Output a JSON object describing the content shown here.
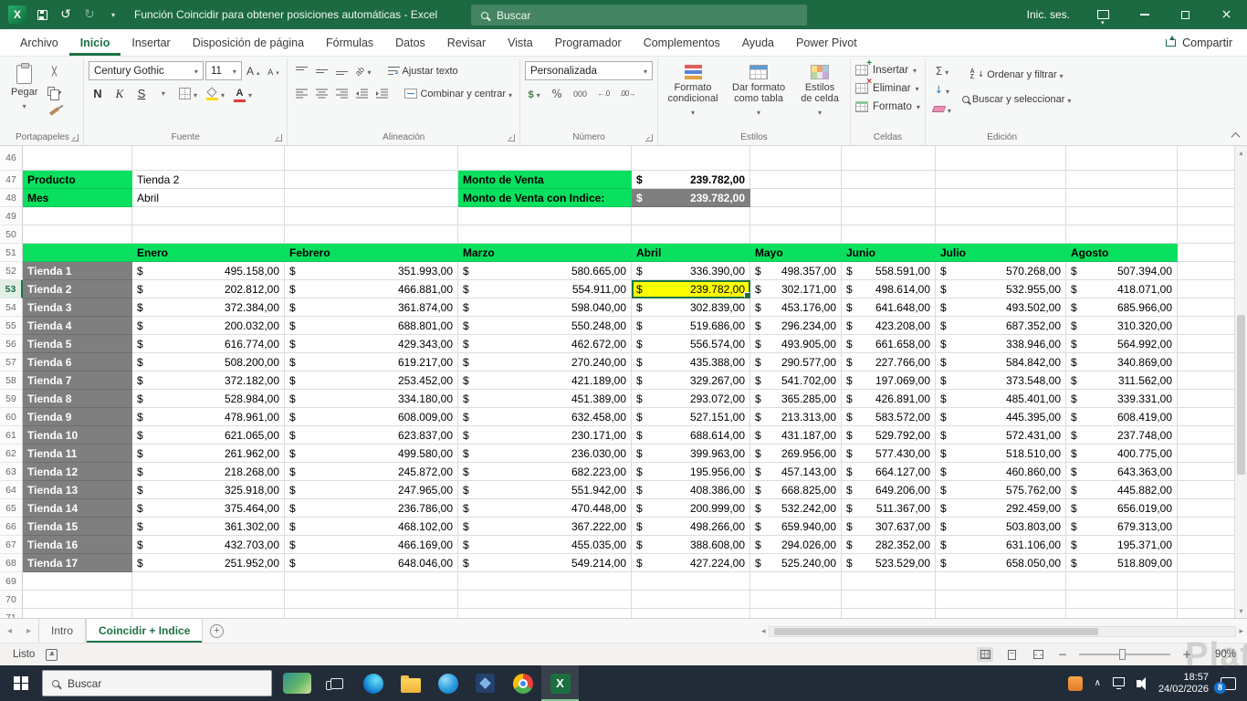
{
  "colors": {
    "titlebar_green": "#1b6a41",
    "accent_green": "#1e7145",
    "header_fill": "#0ae05f",
    "gray_fill": "#7f7f7f",
    "highlight_yellow": "#ffff00",
    "taskbar": "#222c38"
  },
  "icons": {
    "undo": "↺",
    "redo": "↻",
    "close": "×",
    "sigma": "Σ",
    "percent": "%",
    "nav_left": "◂",
    "nav_right": "▸",
    "up": "▴",
    "down": "▾",
    "plus": "+",
    "minus": "−",
    "fill_arrow": "↓",
    "chevron_up": "∧",
    "excel_x": "X"
  },
  "titlebar": {
    "title": "Función Coincidir para obtener posiciones automáticas  -  Excel",
    "search_placeholder": "Buscar",
    "sign_in": "Inic. ses."
  },
  "ribbon_tabs": {
    "items": [
      "Archivo",
      "Inicio",
      "Insertar",
      "Disposición de página",
      "Fórmulas",
      "Datos",
      "Revisar",
      "Vista",
      "Programador",
      "Complementos",
      "Ayuda",
      "Power Pivot"
    ],
    "active": "Inicio",
    "share_label": "Compartir"
  },
  "ribbon": {
    "clipboard": {
      "label": "Portapapeles",
      "paste_label": "Pegar"
    },
    "font": {
      "label": "Fuente",
      "family": "Century Gothic",
      "size": "11",
      "bold": "N",
      "italic": "K",
      "underline": "S"
    },
    "alignment": {
      "label": "Alineación",
      "wrap_label": "Ajustar texto",
      "merge_label": "Combinar y centrar"
    },
    "number": {
      "label": "Número",
      "format": "Personalizada",
      "thousands": "000",
      "inc_decimal": "←.0",
      "dec_decimal": ".00→"
    },
    "styles": {
      "label": "Estilos",
      "conditional_label": "Formato condicional",
      "table_label": "Dar formato como tabla",
      "cell_label": "Estilos de celda"
    },
    "cells": {
      "label": "Celdas",
      "insert_label": "Insertar",
      "delete_label": "Eliminar",
      "format_label": "Formato"
    },
    "editing": {
      "label": "Edición",
      "sort_label": "Ordenar y filtrar",
      "find_label": "Buscar y seleccionar"
    }
  },
  "summary": {
    "product_label": "Producto",
    "product_value": "Tienda 2",
    "month_label": "Mes",
    "month_value": "Abril",
    "sales_label": "Monto de Venta",
    "sales_currency": "$",
    "sales_value": "239.782,00",
    "index_label": "Monto de Venta con Indice:",
    "index_currency": "$",
    "index_value": "239.782,00"
  },
  "table": {
    "currency": "$",
    "months": [
      "Enero",
      "Febrero",
      "Marzo",
      "Abril",
      "Mayo",
      "Junio",
      "Julio",
      "Agosto"
    ],
    "first_visible_row": 46,
    "last_visible_row": 71,
    "highlight": {
      "store": "Tienda 2",
      "month": "Abril"
    },
    "rows": [
      {
        "name": "Tienda 1",
        "values": [
          "495.158,00",
          "351.993,00",
          "580.665,00",
          "336.390,00",
          "498.357,00",
          "558.591,00",
          "570.268,00",
          "507.394,00"
        ]
      },
      {
        "name": "Tienda 2",
        "values": [
          "202.812,00",
          "466.881,00",
          "554.911,00",
          "239.782,00",
          "302.171,00",
          "498.614,00",
          "532.955,00",
          "418.071,00"
        ]
      },
      {
        "name": "Tienda 3",
        "values": [
          "372.384,00",
          "361.874,00",
          "598.040,00",
          "302.839,00",
          "453.176,00",
          "641.648,00",
          "493.502,00",
          "685.966,00"
        ]
      },
      {
        "name": "Tienda 4",
        "values": [
          "200.032,00",
          "688.801,00",
          "550.248,00",
          "519.686,00",
          "296.234,00",
          "423.208,00",
          "687.352,00",
          "310.320,00"
        ]
      },
      {
        "name": "Tienda 5",
        "values": [
          "616.774,00",
          "429.343,00",
          "462.672,00",
          "556.574,00",
          "493.905,00",
          "661.658,00",
          "338.946,00",
          "564.992,00"
        ]
      },
      {
        "name": "Tienda 6",
        "values": [
          "508.200,00",
          "619.217,00",
          "270.240,00",
          "435.388,00",
          "290.577,00",
          "227.766,00",
          "584.842,00",
          "340.869,00"
        ]
      },
      {
        "name": "Tienda 7",
        "values": [
          "372.182,00",
          "253.452,00",
          "421.189,00",
          "329.267,00",
          "541.702,00",
          "197.069,00",
          "373.548,00",
          "311.562,00"
        ]
      },
      {
        "name": "Tienda 8",
        "values": [
          "528.984,00",
          "334.180,00",
          "451.389,00",
          "293.072,00",
          "365.285,00",
          "426.891,00",
          "485.401,00",
          "339.331,00"
        ]
      },
      {
        "name": "Tienda 9",
        "values": [
          "478.961,00",
          "608.009,00",
          "632.458,00",
          "527.151,00",
          "213.313,00",
          "583.572,00",
          "445.395,00",
          "608.419,00"
        ]
      },
      {
        "name": "Tienda 10",
        "values": [
          "621.065,00",
          "623.837,00",
          "230.171,00",
          "688.614,00",
          "431.187,00",
          "529.792,00",
          "572.431,00",
          "237.748,00"
        ]
      },
      {
        "name": "Tienda 11",
        "values": [
          "261.962,00",
          "499.580,00",
          "236.030,00",
          "399.963,00",
          "269.956,00",
          "577.430,00",
          "518.510,00",
          "400.775,00"
        ]
      },
      {
        "name": "Tienda 12",
        "values": [
          "218.268,00",
          "245.872,00",
          "682.223,00",
          "195.956,00",
          "457.143,00",
          "664.127,00",
          "460.860,00",
          "643.363,00"
        ]
      },
      {
        "name": "Tienda 13",
        "values": [
          "325.918,00",
          "247.965,00",
          "551.942,00",
          "408.386,00",
          "668.825,00",
          "649.206,00",
          "575.762,00",
          "445.882,00"
        ]
      },
      {
        "name": "Tienda 14",
        "values": [
          "375.464,00",
          "236.786,00",
          "470.448,00",
          "200.999,00",
          "532.242,00",
          "511.367,00",
          "292.459,00",
          "656.019,00"
        ]
      },
      {
        "name": "Tienda 15",
        "values": [
          "361.302,00",
          "468.102,00",
          "367.222,00",
          "498.266,00",
          "659.940,00",
          "307.637,00",
          "503.803,00",
          "679.313,00"
        ]
      },
      {
        "name": "Tienda 16",
        "values": [
          "432.703,00",
          "466.169,00",
          "455.035,00",
          "388.608,00",
          "294.026,00",
          "282.352,00",
          "631.106,00",
          "195.371,00"
        ]
      },
      {
        "name": "Tienda 17",
        "values": [
          "251.952,00",
          "648.046,00",
          "549.214,00",
          "427.224,00",
          "525.240,00",
          "523.529,00",
          "658.050,00",
          "518.809,00"
        ]
      }
    ]
  },
  "sheet_bar": {
    "tabs": [
      "Intro",
      "Coincidir + Indice"
    ],
    "active": "Coincidir + Indice"
  },
  "status_bar": {
    "mode": "Listo",
    "zoom": "90%"
  },
  "taskbar": {
    "search_placeholder": "Buscar",
    "time": "18:57",
    "date": "24/02/2026",
    "notification_badge": "8"
  },
  "watermark": "Plat"
}
